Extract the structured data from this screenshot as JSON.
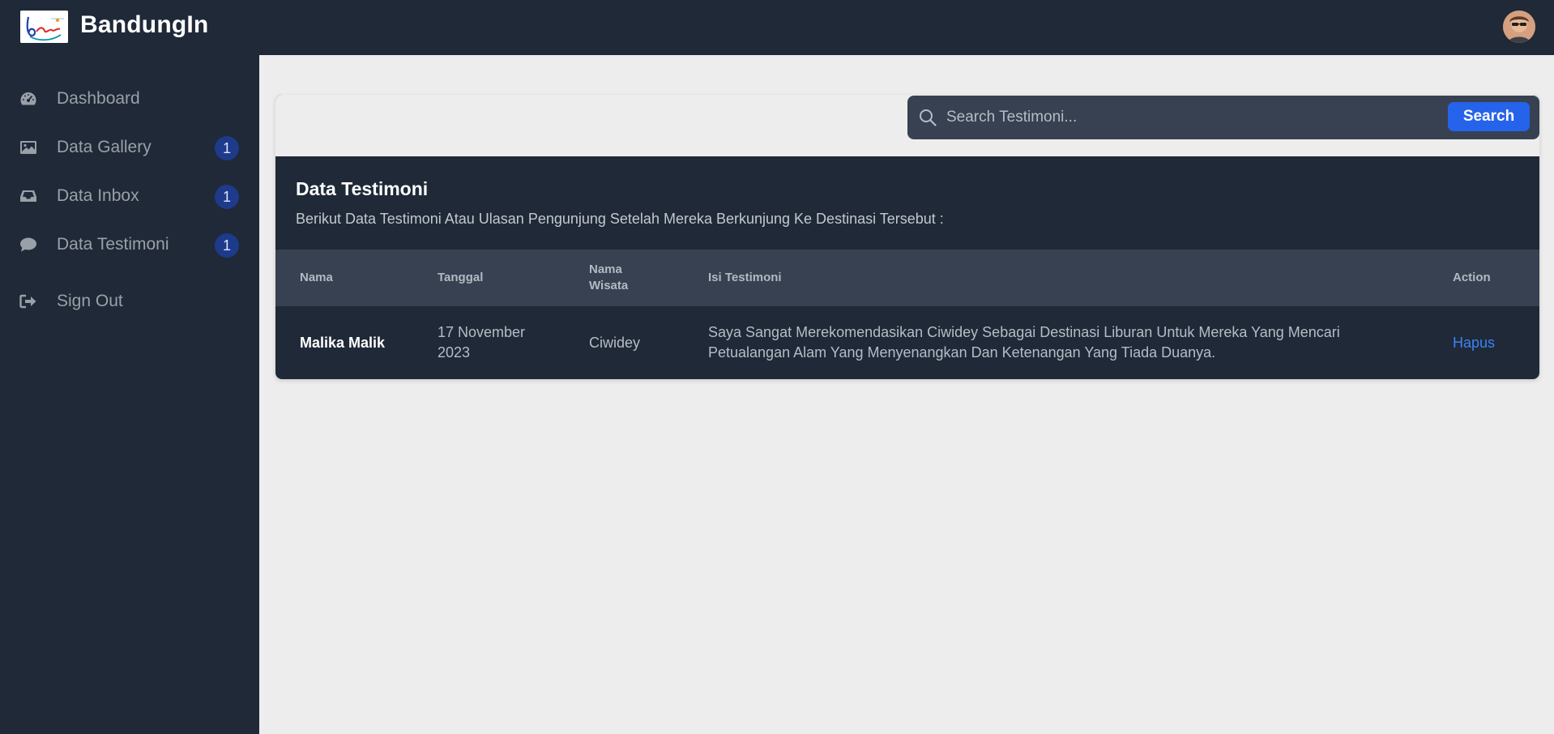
{
  "header": {
    "brand": "BandungIn"
  },
  "sidebar": {
    "items": [
      {
        "label": "Dashboard",
        "icon": "dashboard-icon"
      },
      {
        "label": "Data Gallery",
        "icon": "image-icon",
        "badge": "1"
      },
      {
        "label": "Data Inbox",
        "icon": "inbox-icon",
        "badge": "1"
      },
      {
        "label": "Data Testimoni",
        "icon": "comment-icon",
        "badge": "1"
      },
      {
        "label": "Sign Out",
        "icon": "sign-out-icon"
      }
    ]
  },
  "search": {
    "placeholder": "Search Testimoni...",
    "button_label": "Search"
  },
  "main": {
    "title": "Data Testimoni",
    "subtitle": "Berikut Data Testimoni Atau Ulasan Pengunjung Setelah Mereka Berkunjung Ke Destinasi Tersebut :",
    "columns": [
      "Nama",
      "Tanggal",
      "Nama Wisata",
      "Isi Testimoni",
      "Action"
    ],
    "rows": [
      {
        "nama": "Malika Malik",
        "tanggal": "17 November 2023",
        "nama_wisata": "Ciwidey",
        "isi": "Saya Sangat Merekomendasikan Ciwidey Sebagai Destinasi Liburan Untuk Mereka Yang Mencari Petualangan Alam Yang Menyenangkan Dan Ketenangan Yang Tiada Duanya.",
        "action": "Hapus"
      }
    ]
  },
  "colors": {
    "sidebar_bg": "#1f2937",
    "page_bg": "#ededed",
    "accent": "#2563eb",
    "badge_bg": "#1e3a8a",
    "link": "#3b82f6"
  }
}
